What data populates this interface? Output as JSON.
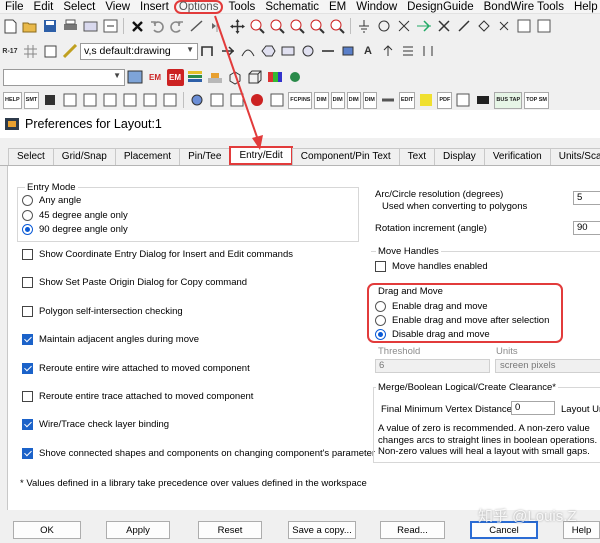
{
  "menu": [
    "File",
    "Edit",
    "Select",
    "View",
    "Insert",
    "Options",
    "Tools",
    "Schematic",
    "EM",
    "Window",
    "DesignGuide",
    "BondWire Tools",
    "Help"
  ],
  "toolbar": {
    "layer_combo": "v,s default:drawing",
    "btn_labels": {
      "smt": "SMT",
      "help": "HELP",
      "edit": "EDIT",
      "em": "EM",
      "pdf": "PDF",
      "fcpins": "FCPINS",
      "dim": "DIM",
      "bussm": "BUS TAP",
      "topsm": "TOP SM"
    }
  },
  "window": {
    "title": "Preferences for Layout:1"
  },
  "tabs": [
    "Select",
    "Grid/Snap",
    "Placement",
    "Pin/Tee",
    "Entry/Edit",
    "Component/Pin Text",
    "Text",
    "Display",
    "Verification",
    "Units/Sca"
  ],
  "entry_mode": {
    "legend": "Entry Mode",
    "options": [
      {
        "label": "Any angle",
        "selected": false
      },
      {
        "label": "45 degree angle only",
        "selected": false
      },
      {
        "label": "90 degree angle only",
        "selected": true
      }
    ]
  },
  "checkboxes": [
    {
      "label": "Show Coordinate Entry Dialog for Insert and Edit commands",
      "checked": false
    },
    {
      "label": "Show Set Paste Origin Dialog for Copy command",
      "checked": false
    },
    {
      "label": "Polygon self-intersection checking",
      "checked": false
    },
    {
      "label": "Maintain adjacent angles during move",
      "checked": true
    },
    {
      "label": "Reroute entire wire attached to moved component",
      "checked": true
    },
    {
      "label": "Reroute entire trace attached to moved component",
      "checked": false
    },
    {
      "label": "Wire/Trace check layer binding",
      "checked": true
    },
    {
      "label": "Shove connected shapes and components on changing component's parameter",
      "checked": true
    }
  ],
  "footnote": "* Values defined in a library take precedence over values defined in the workspace",
  "arc": {
    "label": "Arc/Circle resolution (degrees)",
    "sublabel": "Used when converting to polygons",
    "value": "5",
    "rotation_label": "Rotation increment (angle)",
    "rotation_value": "90"
  },
  "move_handles": {
    "legend": "Move Handles",
    "label": "Move handles enabled",
    "checked": false
  },
  "drag_move": {
    "legend": "Drag and Move",
    "options": [
      {
        "label": "Enable drag and move",
        "selected": false
      },
      {
        "label": "Enable drag and move after selection",
        "selected": false
      },
      {
        "label": "Disable drag and move",
        "selected": true
      }
    ],
    "threshold_label": "Threshold",
    "units_label": "Units",
    "threshold_value": "6",
    "units_value": "screen pixels"
  },
  "merge": {
    "legend": "Merge/Boolean Logical/Create Clearance*",
    "vertex_label": "Final Minimum Vertex Distance",
    "vertex_value": "0",
    "vertex_unit": "Layout Un",
    "note": "A value of zero is recommended.  A non-zero value changes arcs to straight lines in boolean operations. Non-zero values will heal a layout with small gaps."
  },
  "buttons": [
    "OK",
    "Apply",
    "Reset",
    "Save a copy...",
    "Read...",
    "Cancel",
    "Help"
  ],
  "watermark": "知乎 @Louis.Z",
  "colors": {
    "highlight": "#e23b3b",
    "accent": "#1b62c9"
  }
}
